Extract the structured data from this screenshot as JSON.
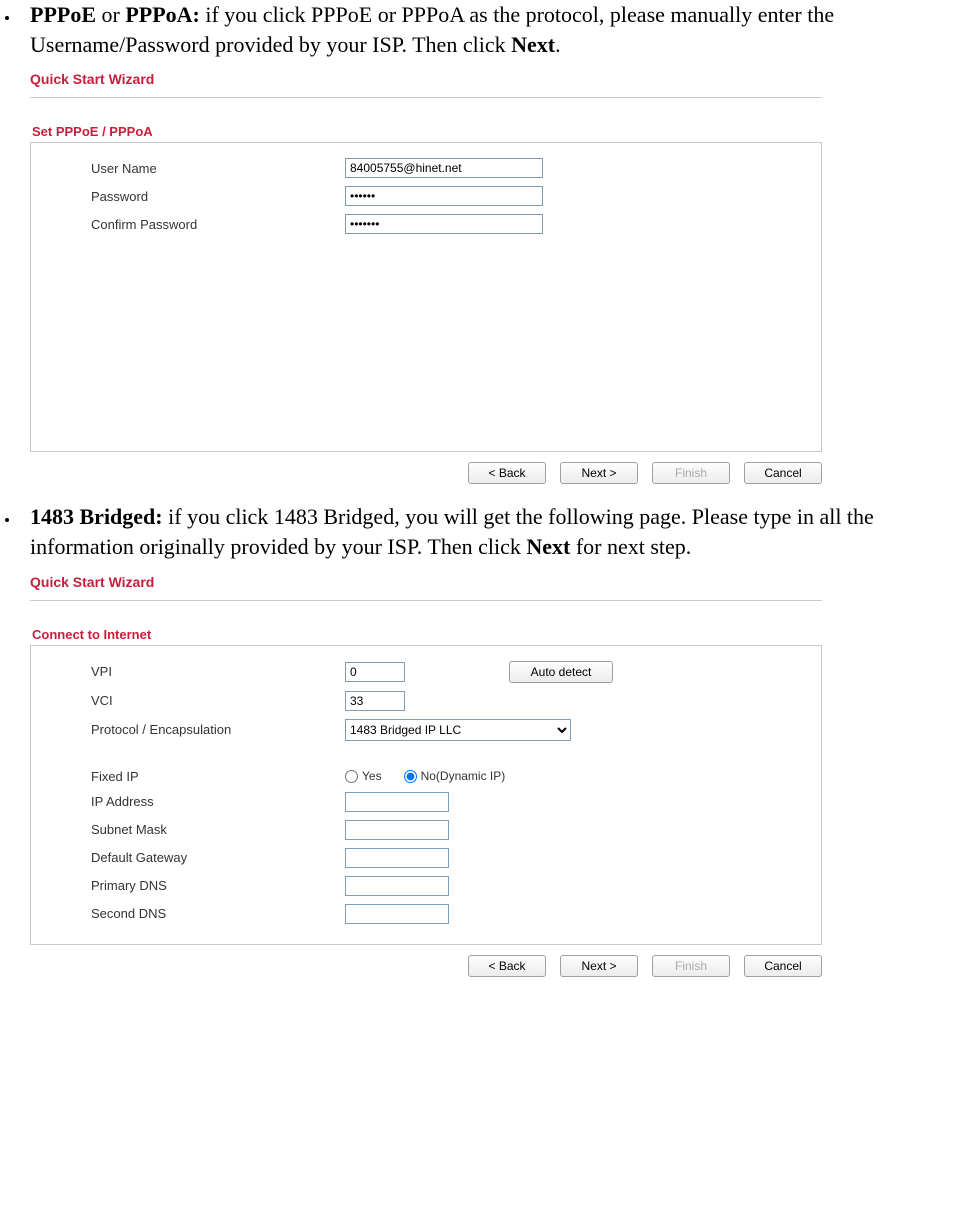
{
  "bullet1": {
    "strong_lead": "PPPoE",
    "mid": " or ",
    "strong_lead2": "PPPoA:",
    "text": " if you click PPPoE or PPPoA as the protocol, please manually enter the Username/Password provided by your ISP. Then click ",
    "strong_tail": "Next",
    "tail_period": "."
  },
  "bullet2": {
    "strong_lead": "1483 Bridged:",
    "text1": " if you click 1483 Bridged, you will get the following page. Please type in all the information originally provided by your ISP. Then click ",
    "strong_mid": "Next",
    "text2": " for next step."
  },
  "wizard": {
    "title": "Quick Start Wizard",
    "buttons": {
      "back": "< Back",
      "next": "Next >",
      "finish": "Finish",
      "cancel": "Cancel"
    }
  },
  "panelA": {
    "section": "Set PPPoE / PPPoA",
    "labels": {
      "user": "User Name",
      "pass": "Password",
      "confirm": "Confirm Password"
    },
    "values": {
      "user": "84005755@hinet.net",
      "pass": "••••••",
      "confirm": "•••••••"
    }
  },
  "panelB": {
    "section": "Connect to Internet",
    "labels": {
      "vpi": "VPI",
      "vci": "VCI",
      "proto": "Protocol / Encapsulation",
      "fixedip": "Fixed IP",
      "ip": "IP Address",
      "subnet": "Subnet Mask",
      "gateway": "Default Gateway",
      "pdns": "Primary DNS",
      "sdns": "Second DNS"
    },
    "values": {
      "vpi": "0",
      "vci": "33",
      "proto": "1483 Bridged IP LLC"
    },
    "radios": {
      "yes": "Yes",
      "no": "No(Dynamic IP)"
    },
    "auto_detect": "Auto detect"
  }
}
